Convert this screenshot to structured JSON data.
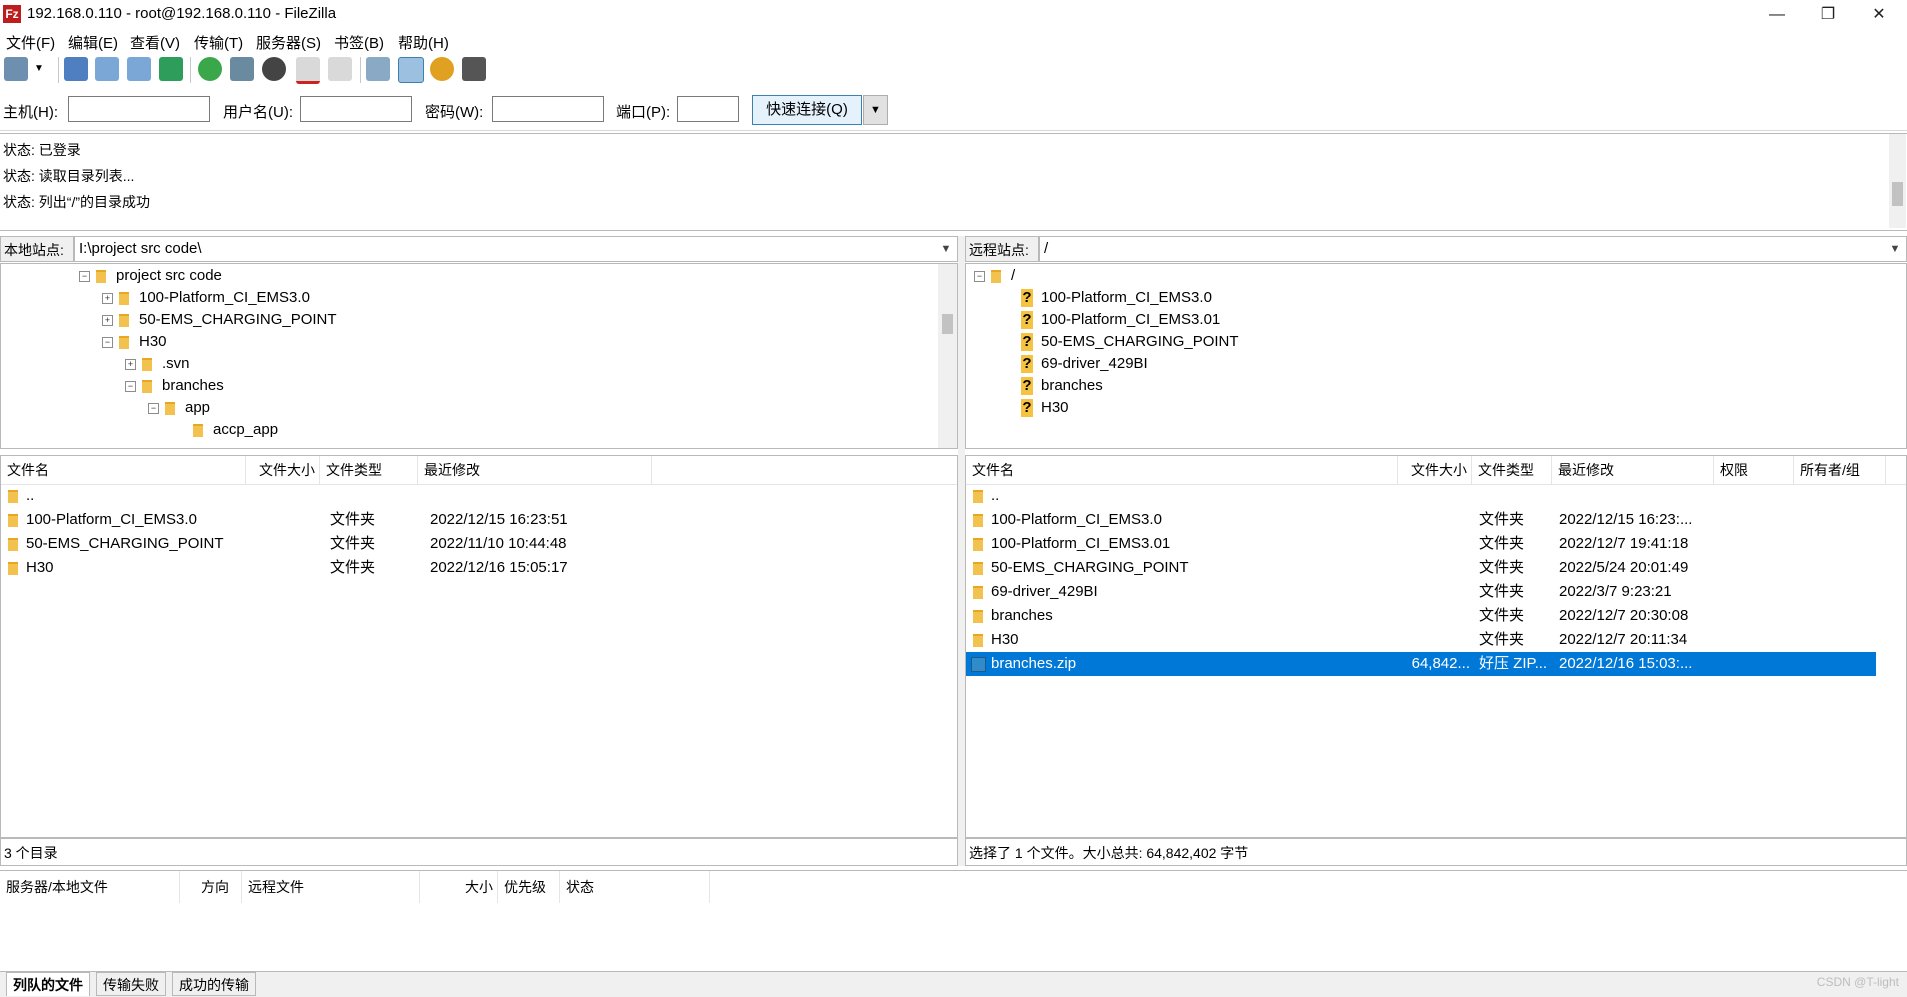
{
  "window": {
    "title": "192.168.0.110 - root@192.168.0.110 - FileZilla",
    "app_icon": "Fz",
    "controls": {
      "minimize": "—",
      "maximize": "❐",
      "close": "✕"
    }
  },
  "menu": [
    "文件(F)",
    "编辑(E)",
    "查看(V)",
    "传输(T)",
    "服务器(S)",
    "书签(B)",
    "帮助(H)"
  ],
  "toolbar": {
    "icons": [
      "site-manager-icon",
      "dropdown-arrow-icon",
      "toggle-log-icon",
      "toggle-local-tree-icon",
      "toggle-remote-tree-icon",
      "toggle-queue-icon",
      "refresh-icon",
      "process-queue-icon",
      "cancel-icon",
      "disconnect-icon",
      "reconnect-icon",
      "directory-comparison-icon",
      "filter-icon",
      "sync-browsing-icon",
      "search-icon"
    ]
  },
  "quickconnect": {
    "host_label": "主机(H):",
    "user_label": "用户名(U):",
    "pass_label": "密码(W):",
    "port_label": "端口(P):",
    "host_value": "",
    "user_value": "",
    "pass_value": "",
    "port_value": "",
    "button_label": "快速连接(Q)",
    "dropdown": "▼"
  },
  "log": [
    "状态: 已登录",
    "状态: 读取目录列表...",
    "状态: 列出“/”的目录成功"
  ],
  "local": {
    "site_label": "本地站点:",
    "path": "I:\\project src code\\",
    "tree": [
      {
        "label": "project src code",
        "expander": "−",
        "depth": 0
      },
      {
        "label": "100-Platform_CI_EMS3.0",
        "expander": "+",
        "depth": 1
      },
      {
        "label": "50-EMS_CHARGING_POINT",
        "expander": "+",
        "depth": 1
      },
      {
        "label": "H30",
        "expander": "−",
        "depth": 1
      },
      {
        "label": ".svn",
        "expander": "+",
        "depth": 2
      },
      {
        "label": "branches",
        "expander": "−",
        "depth": 2
      },
      {
        "label": "app",
        "expander": "−",
        "depth": 3
      },
      {
        "label": "accp_app",
        "expander": "",
        "depth": 4
      }
    ],
    "columns": [
      "文件名",
      "文件大小",
      "文件类型",
      "最近修改"
    ],
    "rows": [
      {
        "name": "..",
        "size": "",
        "type": "",
        "modified": ""
      },
      {
        "name": "100-Platform_CI_EMS3.0",
        "size": "",
        "type": "文件夹",
        "modified": "2022/12/15 16:23:51"
      },
      {
        "name": "50-EMS_CHARGING_POINT",
        "size": "",
        "type": "文件夹",
        "modified": "2022/11/10 10:44:48"
      },
      {
        "name": "H30",
        "size": "",
        "type": "文件夹",
        "modified": "2022/12/16 15:05:17"
      }
    ],
    "status": "3 个目录"
  },
  "remote": {
    "site_label": "远程站点:",
    "path": "/",
    "tree": [
      {
        "label": "/",
        "expander": "−",
        "depth": 0,
        "icon": "folder"
      },
      {
        "label": "100-Platform_CI_EMS3.0",
        "depth": 1,
        "icon": "?"
      },
      {
        "label": "100-Platform_CI_EMS3.01",
        "depth": 1,
        "icon": "?"
      },
      {
        "label": "50-EMS_CHARGING_POINT",
        "depth": 1,
        "icon": "?"
      },
      {
        "label": "69-driver_429BI",
        "depth": 1,
        "icon": "?"
      },
      {
        "label": "branches",
        "depth": 1,
        "icon": "?"
      },
      {
        "label": "H30",
        "depth": 1,
        "icon": "?"
      }
    ],
    "columns": [
      "文件名",
      "文件大小",
      "文件类型",
      "最近修改",
      "权限",
      "所有者/组"
    ],
    "rows": [
      {
        "name": "..",
        "size": "",
        "type": "",
        "modified": "",
        "selected": false,
        "icon": "folder"
      },
      {
        "name": "100-Platform_CI_EMS3.0",
        "size": "",
        "type": "文件夹",
        "modified": "2022/12/15 16:23:...",
        "selected": false,
        "icon": "folder"
      },
      {
        "name": "100-Platform_CI_EMS3.01",
        "size": "",
        "type": "文件夹",
        "modified": "2022/12/7 19:41:18",
        "selected": false,
        "icon": "folder"
      },
      {
        "name": "50-EMS_CHARGING_POINT",
        "size": "",
        "type": "文件夹",
        "modified": "2022/5/24 20:01:49",
        "selected": false,
        "icon": "folder"
      },
      {
        "name": "69-driver_429BI",
        "size": "",
        "type": "文件夹",
        "modified": "2022/3/7 9:23:21",
        "selected": false,
        "icon": "folder"
      },
      {
        "name": "branches",
        "size": "",
        "type": "文件夹",
        "modified": "2022/12/7 20:30:08",
        "selected": false,
        "icon": "folder"
      },
      {
        "name": "H30",
        "size": "",
        "type": "文件夹",
        "modified": "2022/12/7 20:11:34",
        "selected": false,
        "icon": "folder"
      },
      {
        "name": "branches.zip",
        "size": "64,842...",
        "type": "好压 ZIP...",
        "modified": "2022/12/16 15:03:...",
        "selected": true,
        "icon": "zip"
      }
    ],
    "status": "选择了 1 个文件。大小总共: 64,842,402 字节"
  },
  "queue": {
    "columns": [
      "服务器/本地文件",
      "方向",
      "远程文件",
      "大小",
      "优先级",
      "状态"
    ],
    "tabs": [
      "列队的文件",
      "传输失败",
      "成功的传输"
    ]
  },
  "watermark": "CSDN @T-light",
  "colors": {
    "selection": "#0078d7",
    "folder": "#f2c14e",
    "accent_button": "#e5f1fb"
  }
}
